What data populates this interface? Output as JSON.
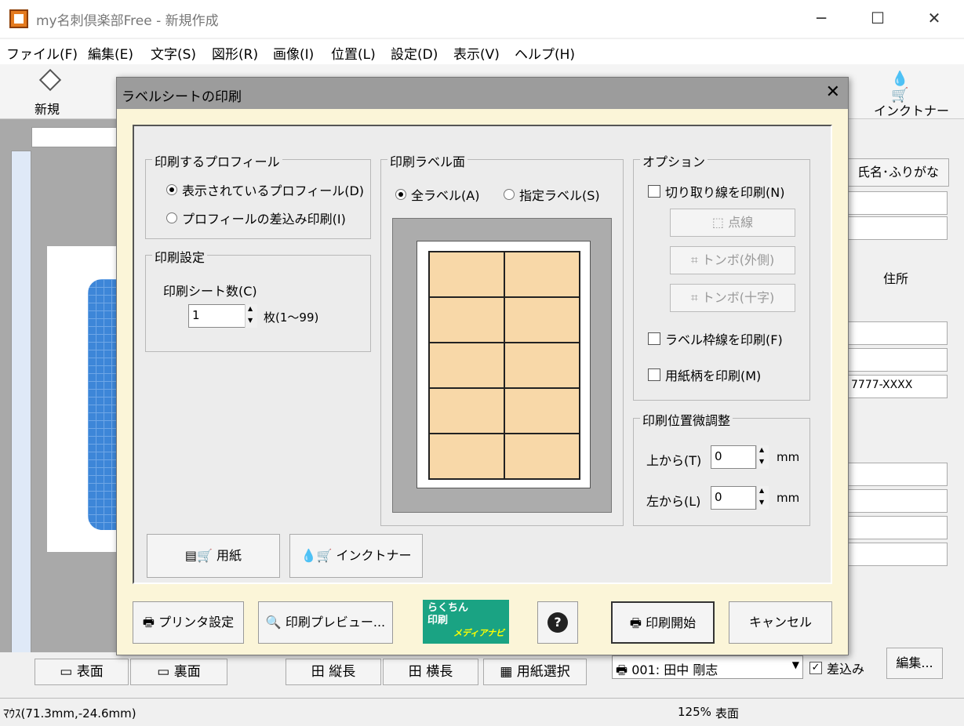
{
  "window": {
    "title": "my名刺倶楽部Free - 新規作成"
  },
  "menu": [
    "ファイル(F)",
    "編集(E)",
    "文字(S)",
    "図形(R)",
    "画像(I)",
    "位置(L)",
    "設定(D)",
    "表示(V)",
    "ヘルプ(H)"
  ],
  "toolbar": {
    "new_label": "新規",
    "ink_label": "インクトナー"
  },
  "right_panel": {
    "name_header": "氏名･ふりがな",
    "address_header": "住所",
    "postal_value": "7777-XXXX"
  },
  "bottom": {
    "front": "表面",
    "back": "裏面",
    "portrait": "縦長",
    "landscape": "横長",
    "paper_select": "用紙選択",
    "record": "001: 田中 剛志",
    "merge_label": "差込み",
    "edit_button": "編集..."
  },
  "statusbar": {
    "mouse": "ﾏｳｽ(71.3mm,-24.6mm)",
    "zoom": "125%",
    "side": "表面"
  },
  "dialog": {
    "title": "ラベルシートの印刷",
    "profile_group": "印刷するプロフィール",
    "profile_opt1": "表示されているプロフィール(D)",
    "profile_opt2": "プロフィールの差込み印刷(I)",
    "settings_group": "印刷設定",
    "sheets_label": "印刷シート数(C)",
    "sheets_value": "1",
    "sheets_range": "枚(1～99)",
    "label_group": "印刷ラベル面",
    "label_all": "全ラベル(A)",
    "label_specified": "指定ラベル(S)",
    "options_group": "オプション",
    "cutline": "切り取り線を印刷(N)",
    "dotted": "点線",
    "tombo_outer": "トンボ(外側)",
    "tombo_cross": "トンボ(十字)",
    "label_border": "ラベル枠線を印刷(F)",
    "paper_pattern": "用紙柄を印刷(M)",
    "adjust_group": "印刷位置微調整",
    "from_top": "上から(T)",
    "top_value": "0",
    "from_left": "左から(L)",
    "left_value": "0",
    "unit": "mm",
    "paper_button": "用紙",
    "ink_button": "インクトナー",
    "printer_setup": "プリンタ設定",
    "print_preview": "印刷プレビュー...",
    "banner_line1": "らくちん",
    "banner_line2": "印刷",
    "banner_line3": "メディアナビ",
    "start_print": "印刷開始",
    "cancel": "キャンセル"
  }
}
